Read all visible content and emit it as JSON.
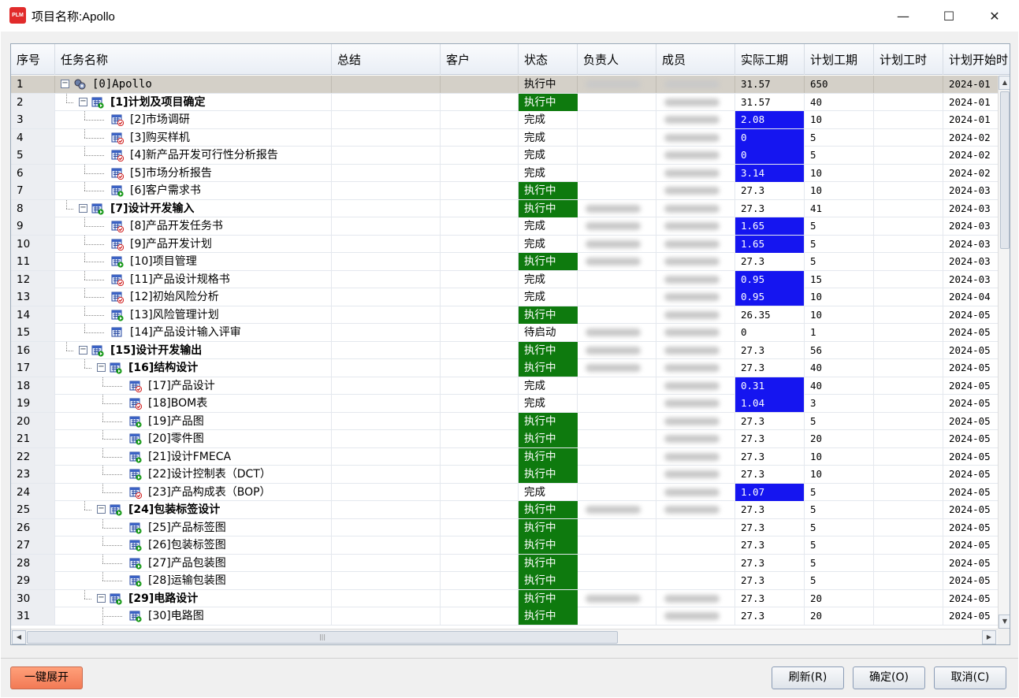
{
  "window": {
    "title": "项目名称:Apollo",
    "logo_text": "PLM",
    "minimize_glyph": "—",
    "maximize_glyph": "☐",
    "close_glyph": "✕"
  },
  "columns": [
    "序号",
    "任务名称",
    "总结",
    "客户",
    "状态",
    "负责人",
    "成员",
    "实际工期",
    "计划工期",
    "计划工时",
    "计划开始时"
  ],
  "rows": [
    {
      "seq": "1",
      "depth": 0,
      "name": "[0]Apollo",
      "bold": false,
      "expander": true,
      "icon": "project-icon",
      "status": "执行中",
      "status_style": "plain",
      "owner": true,
      "members": true,
      "actual": "31.57",
      "actual_blue": false,
      "plan": "650",
      "start": "2024-01",
      "selected": true
    },
    {
      "seq": "2",
      "depth": 1,
      "name": "[1]计划及项目确定",
      "bold": true,
      "expander": true,
      "icon": "phase-icon",
      "status": "执行中",
      "status_style": "run",
      "owner": false,
      "members": true,
      "actual": "31.57",
      "actual_blue": false,
      "plan": "40",
      "start": "2024-01"
    },
    {
      "seq": "3",
      "depth": 2,
      "name": "[2]市场调研",
      "bold": false,
      "expander": false,
      "icon": "task-done-icon",
      "status": "完成",
      "status_style": "plain",
      "owner": false,
      "members": true,
      "actual": "2.08",
      "actual_blue": true,
      "plan": "10",
      "start": "2024-01"
    },
    {
      "seq": "4",
      "depth": 2,
      "name": "[3]购买样机",
      "bold": false,
      "expander": false,
      "icon": "task-done-icon",
      "status": "完成",
      "status_style": "plain",
      "owner": false,
      "members": true,
      "actual": "0",
      "actual_blue": true,
      "plan": "5",
      "start": "2024-02"
    },
    {
      "seq": "5",
      "depth": 2,
      "name": "[4]新产品开发可行性分析报告",
      "bold": false,
      "expander": false,
      "icon": "task-done-icon",
      "status": "完成",
      "status_style": "plain",
      "owner": false,
      "members": true,
      "actual": "0",
      "actual_blue": true,
      "plan": "5",
      "start": "2024-02"
    },
    {
      "seq": "6",
      "depth": 2,
      "name": "[5]市场分析报告",
      "bold": false,
      "expander": false,
      "icon": "task-done-icon",
      "status": "完成",
      "status_style": "plain",
      "owner": false,
      "members": true,
      "actual": "3.14",
      "actual_blue": true,
      "plan": "10",
      "start": "2024-02"
    },
    {
      "seq": "7",
      "depth": 2,
      "name": "[6]客户需求书",
      "bold": false,
      "expander": false,
      "icon": "task-run-icon",
      "status": "执行中",
      "status_style": "run",
      "owner": false,
      "members": true,
      "actual": "27.3",
      "actual_blue": false,
      "plan": "10",
      "start": "2024-03"
    },
    {
      "seq": "8",
      "depth": 1,
      "name": "[7]设计开发输入",
      "bold": true,
      "expander": true,
      "icon": "phase-icon",
      "status": "执行中",
      "status_style": "run",
      "owner": true,
      "members": true,
      "actual": "27.3",
      "actual_blue": false,
      "plan": "41",
      "start": "2024-03"
    },
    {
      "seq": "9",
      "depth": 2,
      "name": "[8]产品开发任务书",
      "bold": false,
      "expander": false,
      "icon": "task-done-icon",
      "status": "完成",
      "status_style": "plain",
      "owner": true,
      "members": true,
      "actual": "1.65",
      "actual_blue": true,
      "plan": "5",
      "start": "2024-03"
    },
    {
      "seq": "10",
      "depth": 2,
      "name": "[9]产品开发计划",
      "bold": false,
      "expander": false,
      "icon": "task-done-icon",
      "status": "完成",
      "status_style": "plain",
      "owner": true,
      "members": true,
      "actual": "1.65",
      "actual_blue": true,
      "plan": "5",
      "start": "2024-03"
    },
    {
      "seq": "11",
      "depth": 2,
      "name": "[10]项目管理",
      "bold": false,
      "expander": false,
      "icon": "task-run-icon",
      "status": "执行中",
      "status_style": "run",
      "owner": true,
      "members": true,
      "actual": "27.3",
      "actual_blue": false,
      "plan": "5",
      "start": "2024-03"
    },
    {
      "seq": "12",
      "depth": 2,
      "name": "[11]产品设计规格书",
      "bold": false,
      "expander": false,
      "icon": "task-done-icon",
      "status": "完成",
      "status_style": "plain",
      "owner": false,
      "members": true,
      "actual": "0.95",
      "actual_blue": true,
      "plan": "15",
      "start": "2024-03"
    },
    {
      "seq": "13",
      "depth": 2,
      "name": "[12]初始风险分析",
      "bold": false,
      "expander": false,
      "icon": "task-done-icon",
      "status": "完成",
      "status_style": "plain",
      "owner": false,
      "members": true,
      "actual": "0.95",
      "actual_blue": true,
      "plan": "10",
      "start": "2024-04"
    },
    {
      "seq": "14",
      "depth": 2,
      "name": "[13]风险管理计划",
      "bold": false,
      "expander": false,
      "icon": "task-run-icon",
      "status": "执行中",
      "status_style": "run",
      "owner": false,
      "members": true,
      "actual": "26.35",
      "actual_blue": false,
      "plan": "10",
      "start": "2024-05"
    },
    {
      "seq": "15",
      "depth": 2,
      "name": "[14]产品设计输入评审",
      "bold": false,
      "expander": false,
      "icon": "task-wait-icon",
      "status": "待启动",
      "status_style": "plain",
      "owner": true,
      "members": true,
      "actual": "0",
      "actual_blue": false,
      "plan": "1",
      "start": "2024-05"
    },
    {
      "seq": "16",
      "depth": 1,
      "name": "[15]设计开发输出",
      "bold": true,
      "expander": true,
      "icon": "phase-icon",
      "status": "执行中",
      "status_style": "run",
      "owner": true,
      "members": true,
      "actual": "27.3",
      "actual_blue": false,
      "plan": "56",
      "start": "2024-05"
    },
    {
      "seq": "17",
      "depth": 2,
      "name": "[16]结构设计",
      "bold": true,
      "expander": true,
      "icon": "phase-icon",
      "status": "执行中",
      "status_style": "run",
      "owner": true,
      "members": true,
      "actual": "27.3",
      "actual_blue": false,
      "plan": "40",
      "start": "2024-05"
    },
    {
      "seq": "18",
      "depth": 3,
      "name": "[17]产品设计",
      "bold": false,
      "expander": false,
      "icon": "task-done-icon",
      "status": "完成",
      "status_style": "plain",
      "owner": false,
      "members": true,
      "actual": "0.31",
      "actual_blue": true,
      "plan": "40",
      "start": "2024-05"
    },
    {
      "seq": "19",
      "depth": 3,
      "name": "[18]BOM表",
      "bold": false,
      "expander": false,
      "icon": "task-done-icon",
      "status": "完成",
      "status_style": "plain",
      "owner": false,
      "members": true,
      "actual": "1.04",
      "actual_blue": true,
      "plan": "3",
      "start": "2024-05"
    },
    {
      "seq": "20",
      "depth": 3,
      "name": "[19]产品图",
      "bold": false,
      "expander": false,
      "icon": "task-run-icon",
      "status": "执行中",
      "status_style": "run",
      "owner": false,
      "members": true,
      "actual": "27.3",
      "actual_blue": false,
      "plan": "5",
      "start": "2024-05"
    },
    {
      "seq": "21",
      "depth": 3,
      "name": "[20]零件图",
      "bold": false,
      "expander": false,
      "icon": "task-run-icon",
      "status": "执行中",
      "status_style": "run",
      "owner": false,
      "members": true,
      "actual": "27.3",
      "actual_blue": false,
      "plan": "20",
      "start": "2024-05"
    },
    {
      "seq": "22",
      "depth": 3,
      "name": "[21]设计FMECA",
      "bold": false,
      "expander": false,
      "icon": "task-run-icon",
      "status": "执行中",
      "status_style": "run",
      "owner": false,
      "members": true,
      "actual": "27.3",
      "actual_blue": false,
      "plan": "10",
      "start": "2024-05"
    },
    {
      "seq": "23",
      "depth": 3,
      "name": "[22]设计控制表（DCT）",
      "bold": false,
      "expander": false,
      "icon": "task-run-icon",
      "status": "执行中",
      "status_style": "run",
      "owner": false,
      "members": true,
      "actual": "27.3",
      "actual_blue": false,
      "plan": "10",
      "start": "2024-05"
    },
    {
      "seq": "24",
      "depth": 3,
      "name": "[23]产品构成表（BOP）",
      "bold": false,
      "expander": false,
      "icon": "task-done-icon",
      "status": "完成",
      "status_style": "plain",
      "owner": false,
      "members": true,
      "actual": "1.07",
      "actual_blue": true,
      "plan": "5",
      "start": "2024-05"
    },
    {
      "seq": "25",
      "depth": 2,
      "name": "[24]包装标签设计",
      "bold": true,
      "expander": true,
      "icon": "phase-icon",
      "status": "执行中",
      "status_style": "run",
      "owner": true,
      "members": true,
      "actual": "27.3",
      "actual_blue": false,
      "plan": "5",
      "start": "2024-05"
    },
    {
      "seq": "26",
      "depth": 3,
      "name": "[25]产品标签图",
      "bold": false,
      "expander": false,
      "icon": "task-run-icon",
      "status": "执行中",
      "status_style": "run",
      "owner": false,
      "members": false,
      "actual": "27.3",
      "actual_blue": false,
      "plan": "5",
      "start": "2024-05"
    },
    {
      "seq": "27",
      "depth": 3,
      "name": "[26]包装标签图",
      "bold": false,
      "expander": false,
      "icon": "task-run-icon",
      "status": "执行中",
      "status_style": "run",
      "owner": false,
      "members": false,
      "actual": "27.3",
      "actual_blue": false,
      "plan": "5",
      "start": "2024-05"
    },
    {
      "seq": "28",
      "depth": 3,
      "name": "[27]产品包装图",
      "bold": false,
      "expander": false,
      "icon": "task-run-icon",
      "status": "执行中",
      "status_style": "run",
      "owner": false,
      "members": false,
      "actual": "27.3",
      "actual_blue": false,
      "plan": "5",
      "start": "2024-05"
    },
    {
      "seq": "29",
      "depth": 3,
      "name": "[28]运输包装图",
      "bold": false,
      "expander": false,
      "icon": "task-run-icon",
      "status": "执行中",
      "status_style": "run",
      "owner": false,
      "members": false,
      "actual": "27.3",
      "actual_blue": false,
      "plan": "5",
      "start": "2024-05"
    },
    {
      "seq": "30",
      "depth": 2,
      "name": "[29]电路设计",
      "bold": true,
      "expander": true,
      "icon": "phase-icon",
      "status": "执行中",
      "status_style": "run",
      "owner": true,
      "members": true,
      "actual": "27.3",
      "actual_blue": false,
      "plan": "20",
      "start": "2024-05"
    },
    {
      "seq": "31",
      "depth": 3,
      "name": "[30]电路图",
      "bold": false,
      "expander": false,
      "icon": "task-run-icon",
      "status": "执行中",
      "status_style": "run",
      "owner": false,
      "members": true,
      "actual": "27.3",
      "actual_blue": false,
      "plan": "20",
      "start": "2024-05"
    }
  ],
  "colors": {
    "status_running_bg": "#0e7a0e",
    "actual_highlight_bg": "#1515f0",
    "selected_row_bg": "#d4d0c8",
    "expand_all_button_bg": "#f27a55"
  },
  "footer": {
    "expand_all_label": "一键展开",
    "refresh_label": "刷新(R)",
    "ok_label": "确定(O)",
    "cancel_label": "取消(C)"
  }
}
